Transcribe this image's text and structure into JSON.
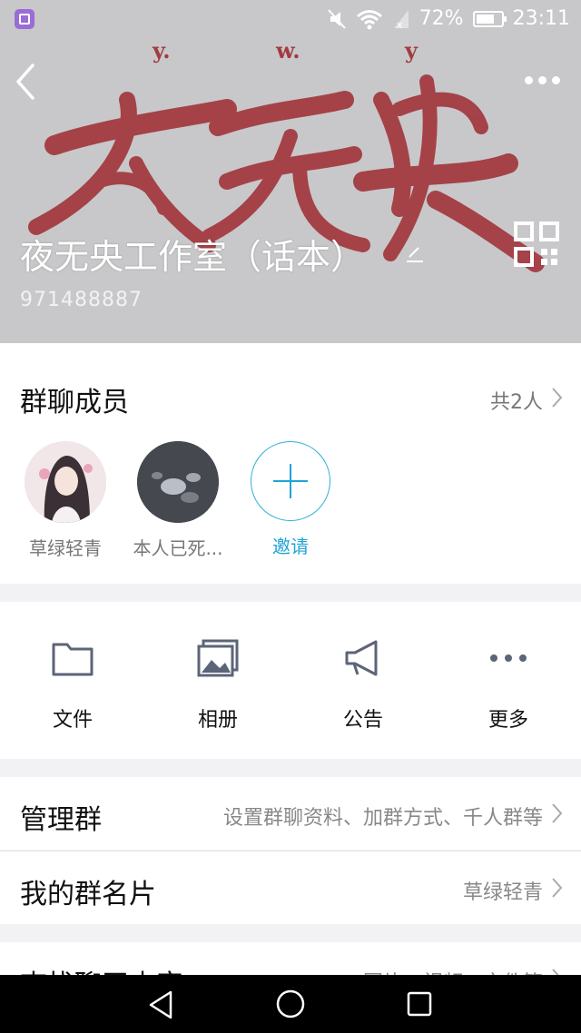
{
  "status_bar": {
    "battery_percent": "72%",
    "time": "23:11",
    "icons": [
      "app-icon",
      "mute-icon",
      "wifi-icon",
      "signal-icon",
      "battery-icon"
    ]
  },
  "header": {
    "banner": {
      "top_letters": [
        "y.",
        "w.",
        "y"
      ],
      "calligraphy": "夜无央",
      "colors": {
        "background": "#c8c8ca",
        "ink": "#a33b42"
      }
    },
    "group_name": "夜无央工作室（话本）",
    "group_id": "971488887"
  },
  "members_section": {
    "title": "群聊成员",
    "count_label": "共2人",
    "members": [
      {
        "name": "草绿轻青"
      },
      {
        "name": "本人已死..."
      }
    ],
    "invite_label": "邀请"
  },
  "tools": [
    {
      "label": "文件",
      "icon": "folder-icon"
    },
    {
      "label": "相册",
      "icon": "album-icon"
    },
    {
      "label": "公告",
      "icon": "megaphone-icon"
    },
    {
      "label": "更多",
      "icon": "more-dots-icon"
    }
  ],
  "settings_rows": [
    {
      "title": "管理群",
      "value": "设置群聊资料、加群方式、千人群等"
    },
    {
      "title": "我的群名片",
      "value": "草绿轻青"
    },
    {
      "title": "查找聊天内容",
      "value": "图片、视频、文件等"
    }
  ],
  "colors": {
    "accent": "#1fa5d6",
    "icon_gray": "#5c6478"
  }
}
